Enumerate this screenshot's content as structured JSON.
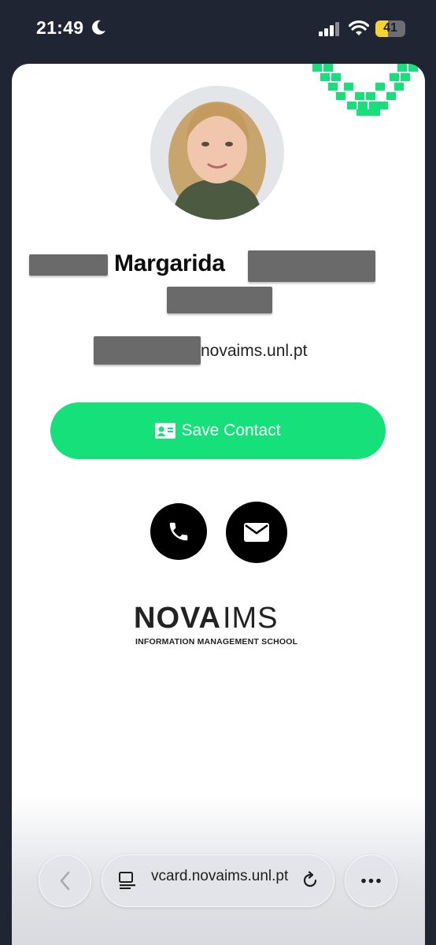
{
  "status_bar": {
    "time": "21:49",
    "battery": 41,
    "battery_label": "41"
  },
  "profile": {
    "name": "Margarida",
    "email_visible": "novaims.unl.pt"
  },
  "actions": {
    "save_label": "Save Contact"
  },
  "logo": {
    "wordmark_left": "NOVA",
    "wordmark_right": "IMS",
    "subtitle": "INFORMATION MANAGEMENT SCHOOL"
  },
  "browser": {
    "url": "vcard.novaims.unl.pt"
  },
  "colors": {
    "accent": "#15e07a",
    "background": "#1f2533"
  }
}
